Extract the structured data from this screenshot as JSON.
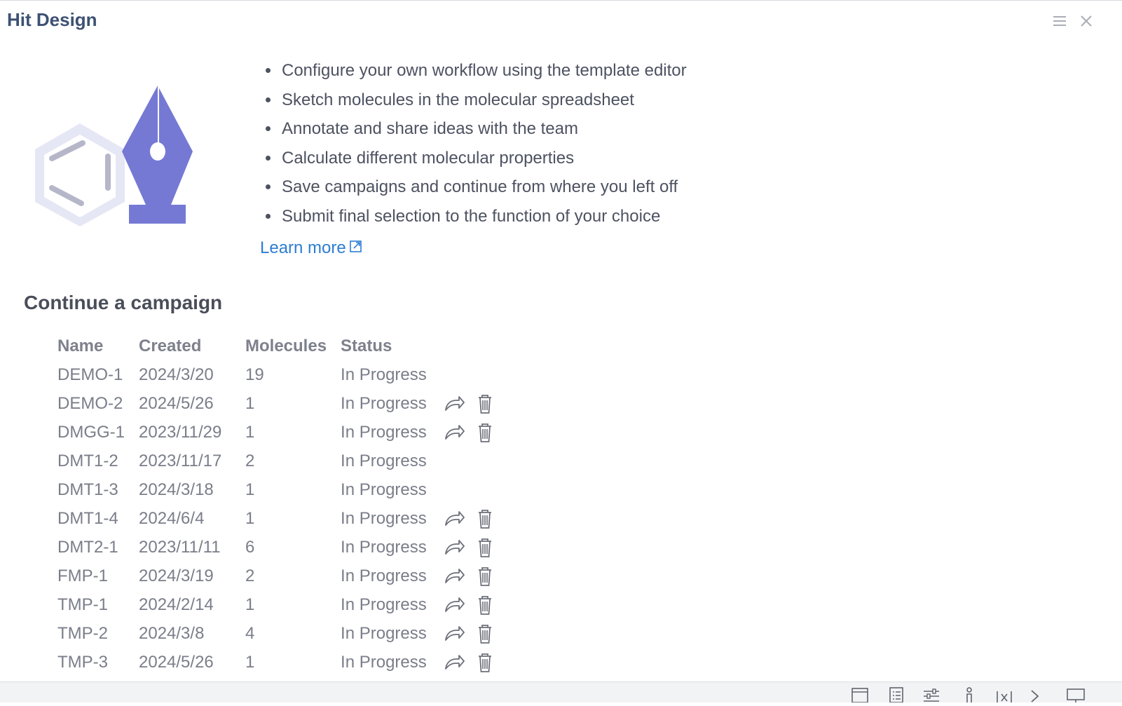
{
  "window": {
    "title": "Hit Design",
    "menu_icon": "hamburger-menu-icon",
    "close_icon": "close-icon"
  },
  "hero": {
    "illustration_icon": "molecule-pen-icon",
    "bullets": [
      "Configure your own workflow using the template editor",
      "Sketch molecules in the molecular spreadsheet",
      "Annotate and share ideas with the team",
      "Calculate different molecular properties",
      "Save campaigns and continue from where you left off",
      "Submit final selection to the function of your choice"
    ],
    "learn_more": "Learn more",
    "learn_more_icon": "external-link-icon"
  },
  "campaigns": {
    "title": "Continue a campaign",
    "headers": [
      "Name",
      "Created",
      "Molecules",
      "Status"
    ],
    "rows": [
      {
        "name": "DEMO-1",
        "created": "2024/3/20",
        "molecules": "19",
        "status": "In Progress",
        "actions": false
      },
      {
        "name": "DEMO-2",
        "created": "2024/5/26",
        "molecules": "1",
        "status": "In Progress",
        "actions": true
      },
      {
        "name": "DMGG-1",
        "created": "2023/11/29",
        "molecules": "1",
        "status": "In Progress",
        "actions": true
      },
      {
        "name": "DMT1-2",
        "created": "2023/11/17",
        "molecules": "2",
        "status": "In Progress",
        "actions": false
      },
      {
        "name": "DMT1-3",
        "created": "2024/3/18",
        "molecules": "1",
        "status": "In Progress",
        "actions": false
      },
      {
        "name": "DMT1-4",
        "created": "2024/6/4",
        "molecules": "1",
        "status": "In Progress",
        "actions": true
      },
      {
        "name": "DMT2-1",
        "created": "2023/11/11",
        "molecules": "6",
        "status": "In Progress",
        "actions": true
      },
      {
        "name": "FMP-1",
        "created": "2024/3/19",
        "molecules": "2",
        "status": "In Progress",
        "actions": true
      },
      {
        "name": "TMP-1",
        "created": "2024/2/14",
        "molecules": "1",
        "status": "In Progress",
        "actions": true
      },
      {
        "name": "TMP-2",
        "created": "2024/3/8",
        "molecules": "4",
        "status": "In Progress",
        "actions": true
      },
      {
        "name": "TMP-3",
        "created": "2024/5/26",
        "molecules": "1",
        "status": "In Progress",
        "actions": true
      }
    ],
    "action_icons": [
      "share-icon",
      "trash-icon"
    ]
  },
  "statusbar": {
    "icons": [
      "window-icon",
      "properties-icon",
      "sliders-icon",
      "person-icon",
      "variables-icon",
      "chevron-right-icon",
      "presentation-icon"
    ]
  },
  "colors": {
    "title": "#3d5173",
    "link": "#2d7dd2",
    "illustration": "#7579d4",
    "illustration_light": "#dfe1f3"
  }
}
